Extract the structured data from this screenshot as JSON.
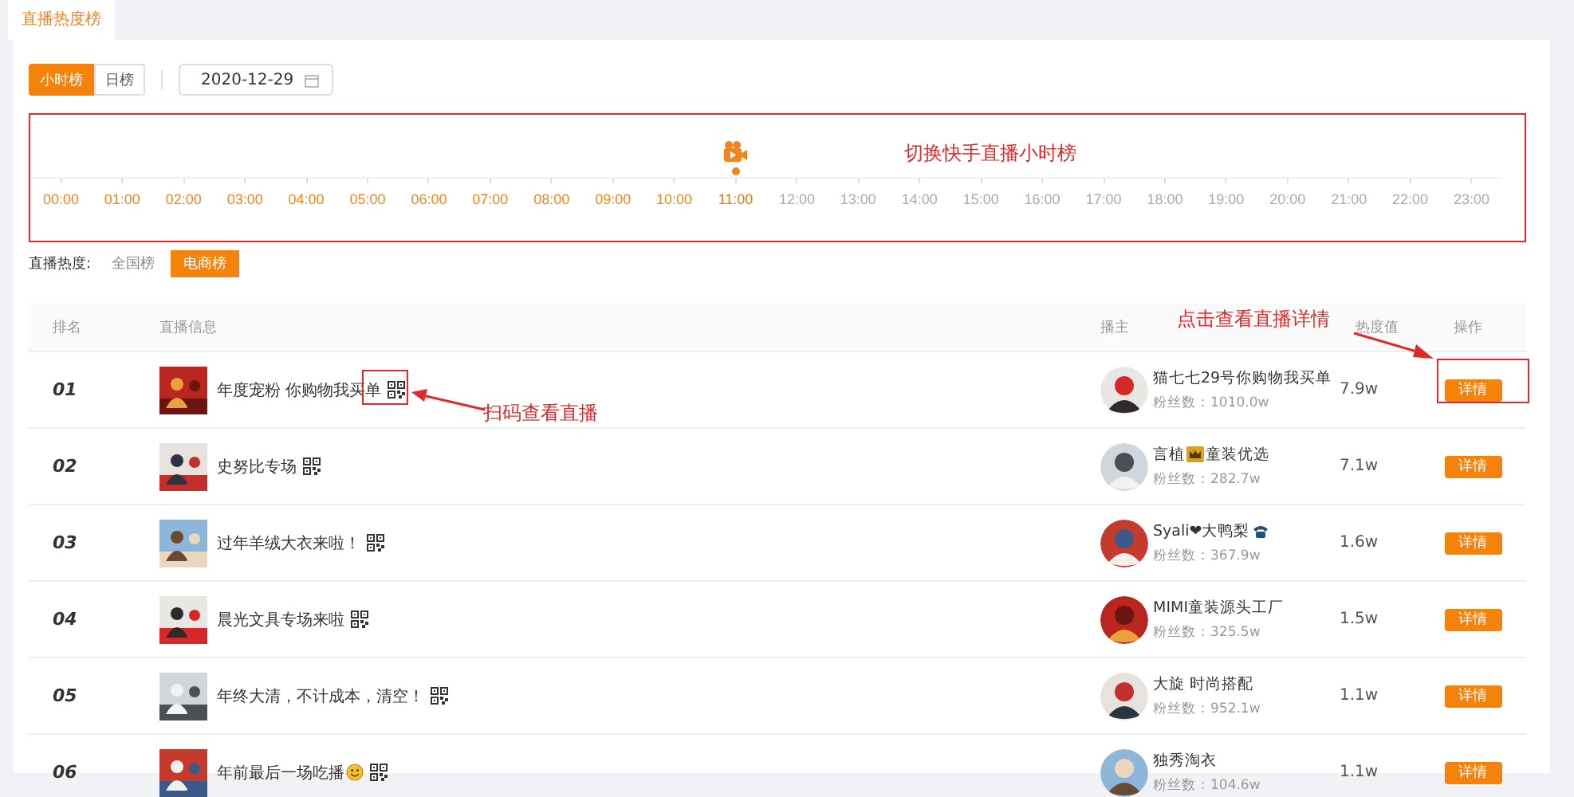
{
  "page_tab": {
    "label": "直播热度榜",
    "selected": true
  },
  "rank_modes": [
    {
      "label": "小时榜",
      "selected": true
    },
    {
      "label": "日榜",
      "selected": false
    }
  ],
  "date_field": {
    "value": "2020-12-29"
  },
  "hours": [
    {
      "label": "00:00",
      "available": true,
      "selected": false
    },
    {
      "label": "01:00",
      "available": true,
      "selected": false
    },
    {
      "label": "02:00",
      "available": true,
      "selected": false
    },
    {
      "label": "03:00",
      "available": true,
      "selected": false
    },
    {
      "label": "04:00",
      "available": true,
      "selected": false
    },
    {
      "label": "05:00",
      "available": true,
      "selected": false
    },
    {
      "label": "06:00",
      "available": true,
      "selected": false
    },
    {
      "label": "07:00",
      "available": true,
      "selected": false
    },
    {
      "label": "08:00",
      "available": true,
      "selected": false
    },
    {
      "label": "09:00",
      "available": true,
      "selected": false
    },
    {
      "label": "10:00",
      "available": true,
      "selected": false
    },
    {
      "label": "11:00",
      "available": true,
      "selected": true
    },
    {
      "label": "12:00",
      "available": false,
      "selected": false
    },
    {
      "label": "13:00",
      "available": false,
      "selected": false
    },
    {
      "label": "14:00",
      "available": false,
      "selected": false
    },
    {
      "label": "15:00",
      "available": false,
      "selected": false
    },
    {
      "label": "16:00",
      "available": false,
      "selected": false
    },
    {
      "label": "17:00",
      "available": false,
      "selected": false
    },
    {
      "label": "18:00",
      "available": false,
      "selected": false
    },
    {
      "label": "19:00",
      "available": false,
      "selected": false
    },
    {
      "label": "20:00",
      "available": false,
      "selected": false
    },
    {
      "label": "21:00",
      "available": false,
      "selected": false
    },
    {
      "label": "22:00",
      "available": false,
      "selected": false
    },
    {
      "label": "23:00",
      "available": false,
      "selected": false
    }
  ],
  "heat_filter": {
    "label": "直播热度:",
    "options": [
      {
        "label": "全国榜",
        "selected": false
      },
      {
        "label": "电商榜",
        "selected": true
      }
    ]
  },
  "table": {
    "columns": [
      "排名",
      "直播信息",
      "播主",
      "热度值",
      "操作"
    ],
    "rows": [
      {
        "rank": "01",
        "kind": "plain",
        "title": "年度宠粉 你购物我买单",
        "host": [
          {
            "kind": "text",
            "text": "猫七七29号你购物我买单"
          }
        ],
        "fans": "粉丝数：1010.0w",
        "heat": "7.9w",
        "action": "详情"
      },
      {
        "rank": "02",
        "kind": "plain",
        "title": "史努比专场",
        "host": [
          {
            "kind": "text",
            "text": "言植 "
          },
          {
            "kind": "crown"
          },
          {
            "kind": "text",
            "text": "童装优选"
          }
        ],
        "fans": "粉丝数：282.7w",
        "heat": "7.1w",
        "action": "详情"
      },
      {
        "rank": "03",
        "kind": "plain",
        "title": "过年羊绒大衣来啦！",
        "host": [
          {
            "kind": "text",
            "text": "Syali❤大鸭梨"
          },
          {
            "kind": "phone"
          }
        ],
        "fans": "粉丝数：367.9w",
        "heat": "1.6w",
        "action": "详情"
      },
      {
        "rank": "04",
        "kind": "plain",
        "title": "晨光文具专场来啦",
        "host": [
          {
            "kind": "text",
            "text": "MIMI童装源头工厂"
          }
        ],
        "fans": "粉丝数：325.5w",
        "heat": "1.5w",
        "action": "详情"
      },
      {
        "rank": "05",
        "kind": "plain",
        "title": "年终大清，不计成本，清空！",
        "host": [
          {
            "kind": "text",
            "text": "大旋 时尚搭配"
          }
        ],
        "fans": "粉丝数：952.1w",
        "heat": "1.1w",
        "action": "详情"
      },
      {
        "rank": "06",
        "kind": "smiley",
        "title": "年前最后一场吃播",
        "host": [
          {
            "kind": "text",
            "text": "独秀淘衣"
          }
        ],
        "fans": "粉丝数：104.6w",
        "heat": "1.1w",
        "action": "详情"
      }
    ]
  },
  "annotations": [
    {
      "kind": "timeline",
      "text": "切换快手直播小时榜"
    },
    {
      "kind": "qr",
      "text": "扫码查看直播"
    },
    {
      "kind": "detail",
      "text": "点击查看直播详情"
    }
  ]
}
